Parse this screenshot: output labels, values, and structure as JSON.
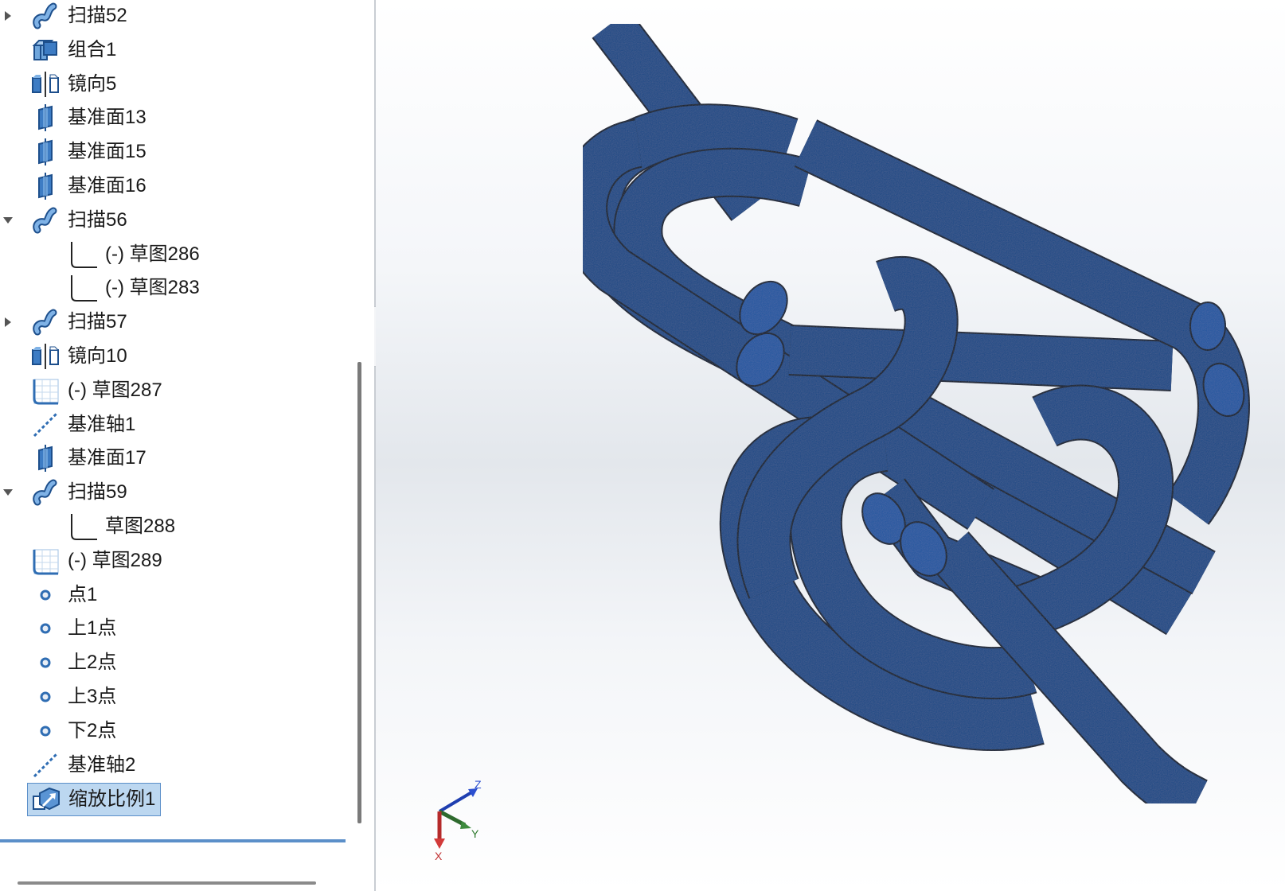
{
  "feature_tree": {
    "items": [
      {
        "label": "扫描52",
        "icon": "sweep-icon",
        "expander": "collapsed"
      },
      {
        "label": "组合1",
        "icon": "combine-icon",
        "expander": "none"
      },
      {
        "label": "镜向5",
        "icon": "mirror-icon",
        "expander": "none"
      },
      {
        "label": "基准面13",
        "icon": "plane-icon",
        "expander": "none"
      },
      {
        "label": "基准面15",
        "icon": "plane-icon",
        "expander": "none"
      },
      {
        "label": "基准面16",
        "icon": "plane-icon",
        "expander": "none"
      },
      {
        "label": "扫描56",
        "icon": "sweep-icon",
        "expander": "expanded"
      },
      {
        "label": "(-) 草图286",
        "icon": "sketch-icon",
        "expander": "none",
        "child": true
      },
      {
        "label": "(-) 草图283",
        "icon": "sketch-icon",
        "expander": "none",
        "child": true
      },
      {
        "label": "扫描57",
        "icon": "sweep-icon",
        "expander": "collapsed"
      },
      {
        "label": "镜向10",
        "icon": "mirror-icon",
        "expander": "none"
      },
      {
        "label": "(-) 草图287",
        "icon": "sketch3d-icon",
        "expander": "none"
      },
      {
        "label": "基准轴1",
        "icon": "axis-icon",
        "expander": "none"
      },
      {
        "label": "基准面17",
        "icon": "plane-icon",
        "expander": "none"
      },
      {
        "label": "扫描59",
        "icon": "sweep-icon",
        "expander": "expanded"
      },
      {
        "label": "草图288",
        "icon": "sketch-icon",
        "expander": "none",
        "child": true
      },
      {
        "label": "(-) 草图289",
        "icon": "sketch3d-icon",
        "expander": "none"
      },
      {
        "label": "点1",
        "icon": "point-icon",
        "expander": "none"
      },
      {
        "label": "上1点",
        "icon": "point-icon",
        "expander": "none"
      },
      {
        "label": "上2点",
        "icon": "point-icon",
        "expander": "none"
      },
      {
        "label": "上3点",
        "icon": "point-icon",
        "expander": "none"
      },
      {
        "label": "下2点",
        "icon": "point-icon",
        "expander": "none"
      },
      {
        "label": "基准轴2",
        "icon": "axis-icon",
        "expander": "none"
      },
      {
        "label": "缩放比例1",
        "icon": "scale-icon",
        "expander": "none",
        "selected": true
      }
    ]
  },
  "triad": {
    "z": "Z",
    "y": "Y",
    "x": "X"
  },
  "colors": {
    "model_fill": "#1a4a86",
    "model_edge": "#0a1a33",
    "selection": "#bcd7f0",
    "icon_blue": "#2f6db3"
  }
}
